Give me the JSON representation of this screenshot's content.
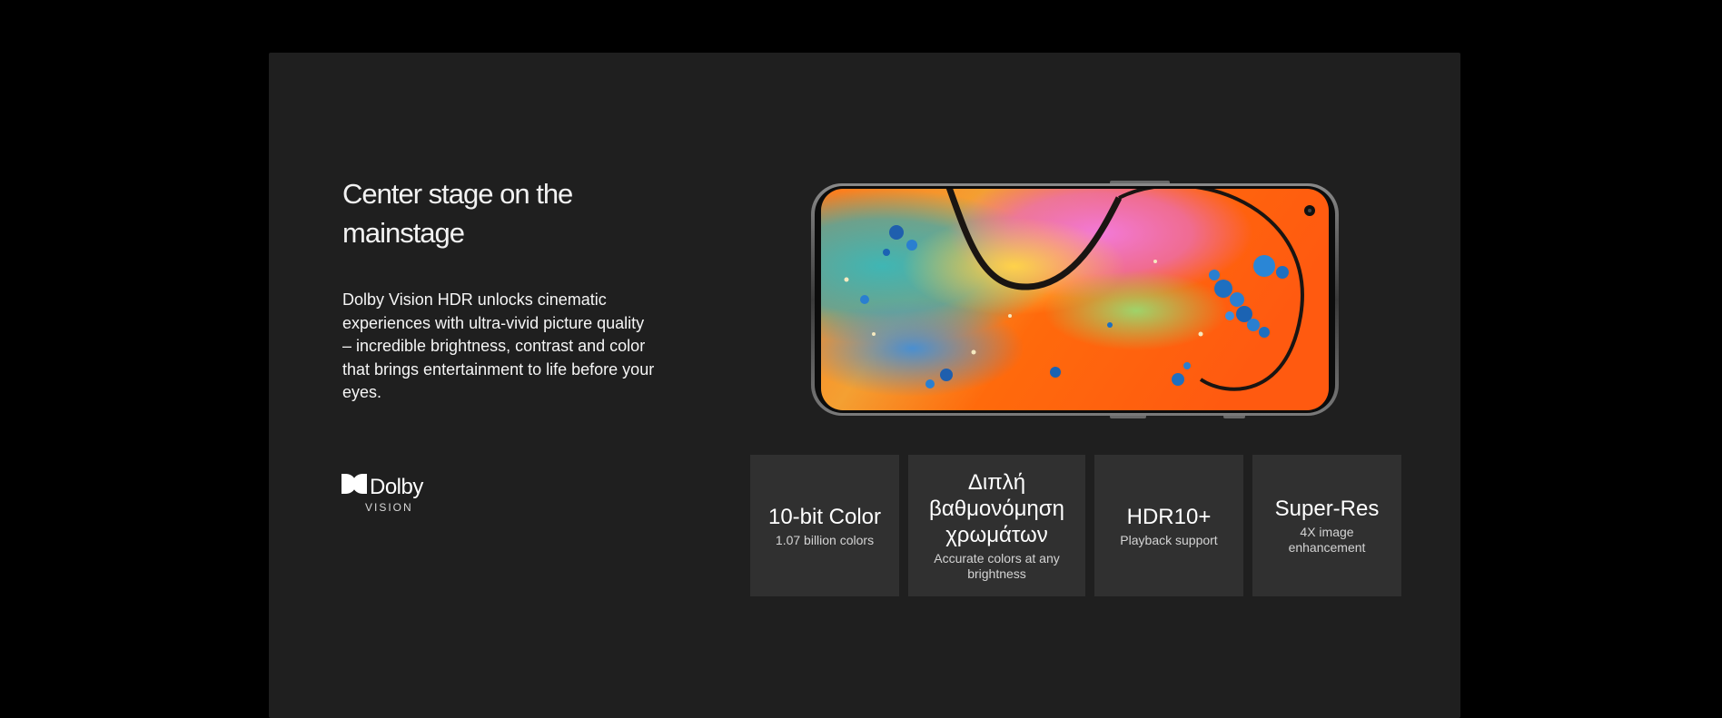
{
  "section": {
    "headline": "Center stage on the mainstage",
    "description": "Dolby Vision HDR unlocks cinematic experiences with ultra-vivid picture quality – incredible brightness, contrast and color that brings entertainment to life before your eyes."
  },
  "dolby": {
    "word": "Dolby",
    "sub": "VISION"
  },
  "features": [
    {
      "title": "10-bit Color",
      "subtitle": "1.07 billion colors"
    },
    {
      "title": "Διπλή βαθμονόμηση χρωμάτων",
      "subtitle": "Accurate colors at any brightness"
    },
    {
      "title": "HDR10+",
      "subtitle": "Playback support"
    },
    {
      "title": "Super-Res",
      "subtitle": "4X image enhancement"
    }
  ],
  "colors": {
    "page_background": "#000000",
    "panel_background": "#1f1f1f",
    "card_background": "#303030"
  }
}
